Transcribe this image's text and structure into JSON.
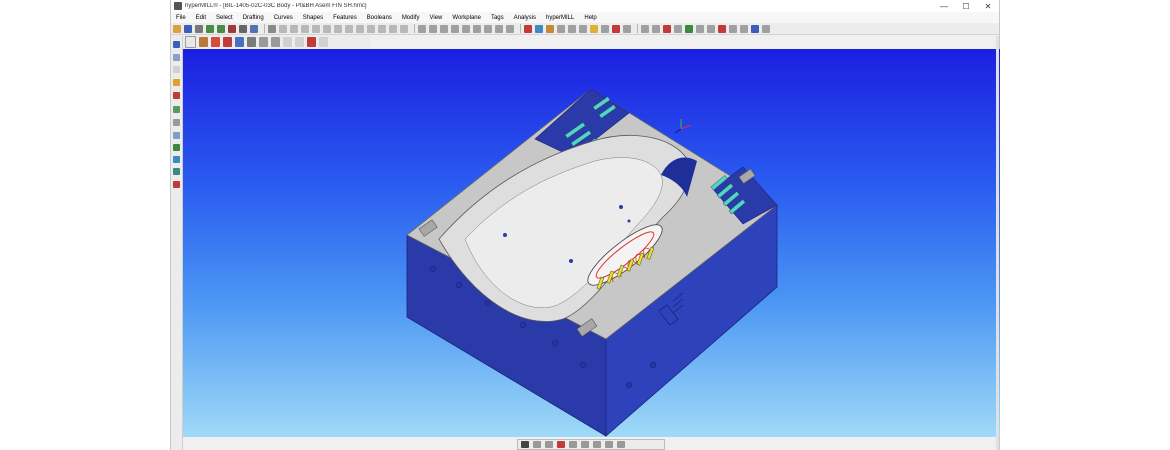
{
  "window": {
    "title": "hyperMILL® - [BIL-1405-02C-03C Body - Pt&BH Asem FIN SH.hmc]",
    "minimize_glyph": "—",
    "maximize_glyph": "☐",
    "close_glyph": "✕"
  },
  "menu": {
    "items": [
      "File",
      "Edit",
      "Select",
      "Drafting",
      "Curves",
      "Shapes",
      "Features",
      "Booleans",
      "Modify",
      "View",
      "Workplane",
      "Tags",
      "Analysis",
      "hyperMILL",
      "Help"
    ]
  },
  "colors": {
    "viewport_top": "#1b1fe0",
    "viewport_bottom": "#9fdaf7",
    "part_side": "#2f3fb4",
    "part_top": "#c8c8c8",
    "cooling_channel": "#56d3c9",
    "toolpath": "#e03030",
    "pins": "#e4de38"
  },
  "toolbar_icons": [
    "open-icon",
    "save-icon",
    "print-icon",
    "undo-icon",
    "redo-icon",
    "select-icon",
    "zoom-icon",
    "rotate-icon",
    "pan-icon",
    "line-icon",
    "arc-icon",
    "circle-icon",
    "curve-icon",
    "measure-icon",
    "shade-icon",
    "wireframe-icon",
    "layer-icon",
    "color-icon",
    "delete-icon",
    "check-icon",
    "settings-icon"
  ]
}
